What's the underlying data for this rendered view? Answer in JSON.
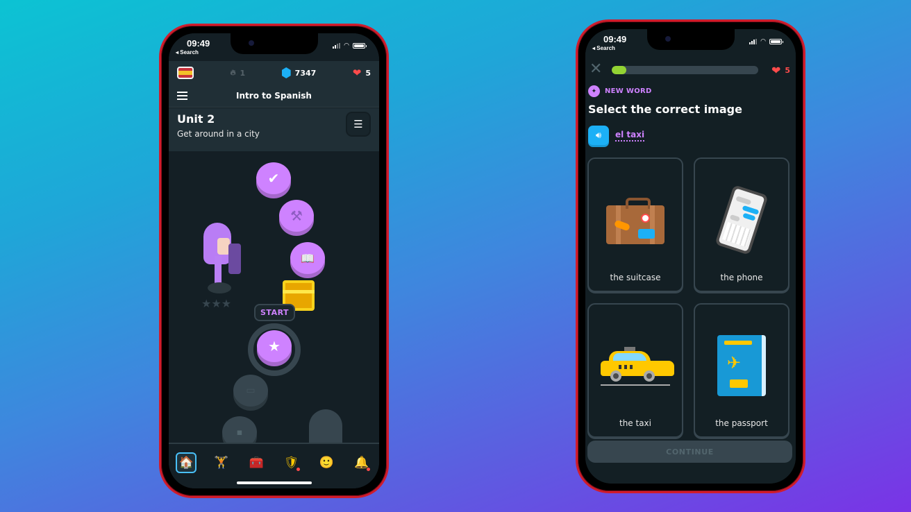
{
  "status_bar": {
    "time": "09:49",
    "back_label": "◂ Search"
  },
  "left_phone": {
    "stats": {
      "flag_icon": "spain-flag-icon",
      "streak": "1",
      "gems": "7347",
      "hearts": "5"
    },
    "course_title": "Intro to Spanish",
    "unit": {
      "title": "Unit 2",
      "subtitle": "Get around in a city",
      "guide_icon": "notebook-icon"
    },
    "path": {
      "nodes": [
        {
          "icon": "check-icon",
          "glyph": "✔",
          "state": "completed"
        },
        {
          "icon": "dumbbell-icon",
          "glyph": "⚒",
          "state": "completed"
        },
        {
          "icon": "book-icon",
          "glyph": "📖",
          "state": "completed"
        },
        {
          "icon": "chest-icon",
          "state": "reward"
        },
        {
          "icon": "star-icon",
          "glyph": "★",
          "state": "current"
        },
        {
          "icon": "book-icon",
          "glyph": "📖",
          "state": "locked"
        },
        {
          "icon": "lock-icon",
          "glyph": "🔒",
          "state": "locked"
        }
      ],
      "start_label": "START",
      "character_stars": "★★★"
    },
    "bottom_nav": [
      {
        "name": "home",
        "glyph": "🏠",
        "active": true,
        "badge": false
      },
      {
        "name": "practice",
        "glyph": "🏋",
        "active": false,
        "badge": false
      },
      {
        "name": "chest",
        "glyph": "🧰",
        "active": false,
        "badge": false
      },
      {
        "name": "leagues",
        "glyph": "🛡",
        "active": false,
        "badge": true
      },
      {
        "name": "profile",
        "glyph": "🙂",
        "active": false,
        "badge": false
      },
      {
        "name": "notifications",
        "glyph": "🔔",
        "active": false,
        "badge": true
      }
    ]
  },
  "right_phone": {
    "close_glyph": "✕",
    "progress_fraction": 0.1,
    "hearts": "5",
    "tag": "NEW WORD",
    "question": "Select the correct image",
    "word": "el taxi",
    "choices": [
      {
        "label": "the suitcase",
        "image": "suitcase"
      },
      {
        "label": "the phone",
        "image": "phone"
      },
      {
        "label": "the taxi",
        "image": "taxi"
      },
      {
        "label": "the passport",
        "image": "passport"
      }
    ],
    "continue_label": "CONTINUE"
  },
  "colors": {
    "accent_purple": "#ce82ff",
    "progress_green": "#93d333",
    "heart_red": "#ff4b4b",
    "gem_blue": "#1cb0f6",
    "frame_red": "#d01c2c"
  }
}
